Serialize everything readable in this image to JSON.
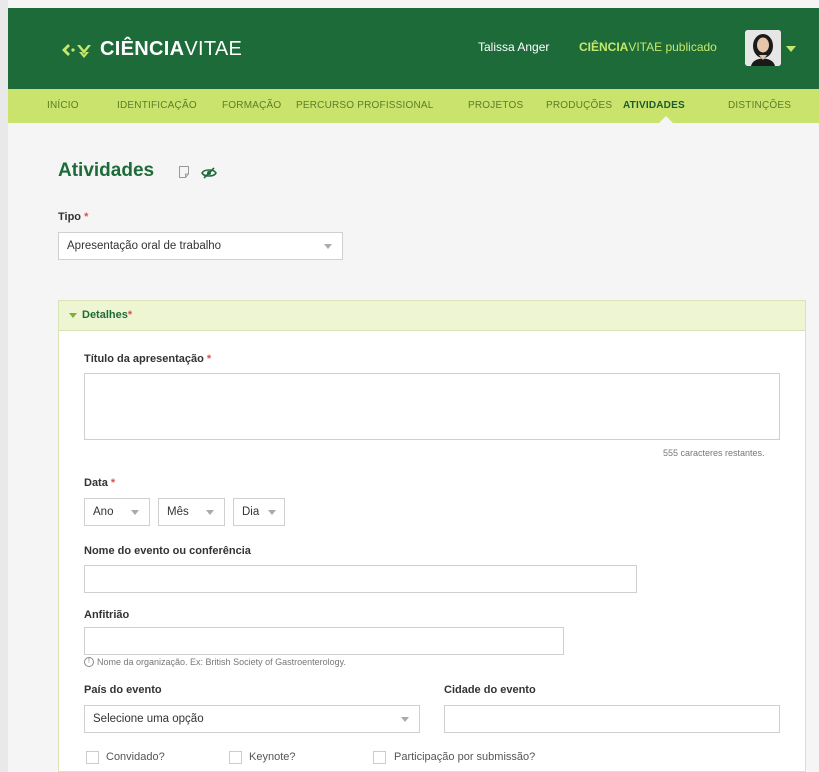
{
  "header": {
    "logo_bold": "CIÊNCIA",
    "logo_light": "VITAE",
    "user_name": "Talissa Anger",
    "published_bold": "CIÊNCIA",
    "published_rest": "VITAE publicado"
  },
  "nav": {
    "items": [
      "INÍCIO",
      "IDENTIFICAÇÃO",
      "FORMAÇÃO",
      "PERCURSO PROFISSIONAL",
      "PROJETOS",
      "PRODUÇÕES",
      "ATIVIDADES",
      "DISTINÇÕES"
    ],
    "active": "ATIVIDADES"
  },
  "page": {
    "title": "Atividades",
    "tipo_label": "Tipo",
    "tipo_value": "Apresentação oral de trabalho",
    "required_mark": "*"
  },
  "details": {
    "section_title": "Detalhes",
    "titulo_label": "Título da apresentação",
    "chars_remaining": "555 caracteres restantes.",
    "data_label": "Data",
    "year_select": "Ano",
    "month_select": "Mês",
    "day_select": "Dia",
    "evento_label": "Nome do evento ou conferência",
    "anfitriao_label": "Anfitrião",
    "anfitriao_hint": "Nome da organização. Ex: British Society of Gastroenterology.",
    "pais_label": "País do evento",
    "pais_value": "Selecione uma opção",
    "cidade_label": "Cidade do evento",
    "convidado_label": "Convidado?",
    "keynote_label": "Keynote?",
    "submissao_label": "Participação por submissão?"
  },
  "colors": {
    "brand_green": "#1e6b3a",
    "nav_lime": "#c9e36c",
    "accent_lime": "#c5e86c",
    "required_red": "#d9534f"
  }
}
